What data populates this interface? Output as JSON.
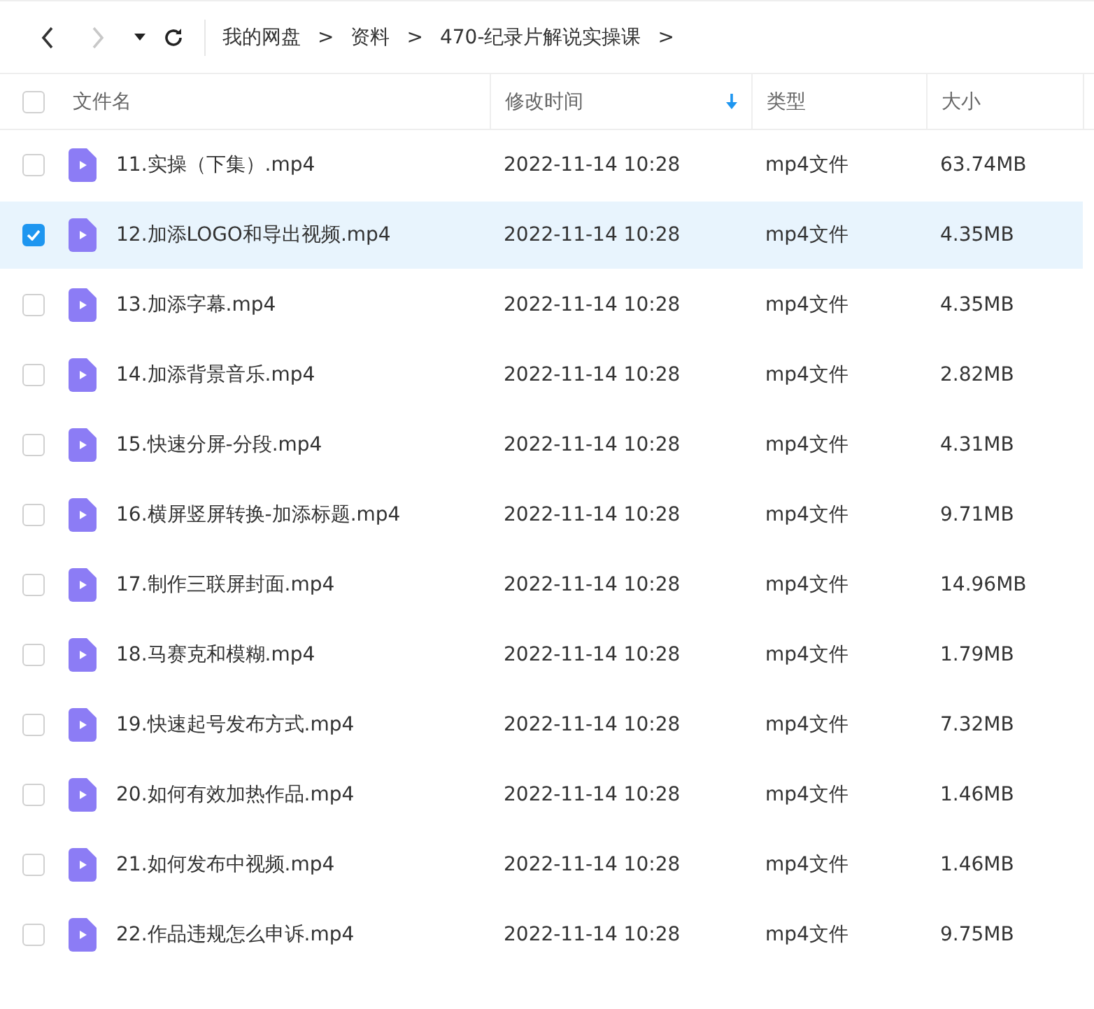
{
  "toolbar": {
    "back": {
      "disabled": false
    },
    "forward": {
      "disabled": true
    }
  },
  "breadcrumb": {
    "separator": ">",
    "items": [
      "我的网盘",
      "资料",
      "470-纪录片解说实操课"
    ]
  },
  "table": {
    "all_checked": false,
    "columns": [
      {
        "label": "文件名",
        "sorted": false
      },
      {
        "label": "修改时间",
        "sorted": true
      },
      {
        "label": "类型",
        "sorted": false
      },
      {
        "label": "大小",
        "sorted": false
      }
    ],
    "rows": [
      {
        "name": "11.实操（下集）.mp4",
        "modified": "2022-11-14 10:28",
        "type": "mp4文件",
        "size": "63.74MB",
        "selected": false
      },
      {
        "name": "12.加添LOGO和导出视频.mp4",
        "modified": "2022-11-14 10:28",
        "type": "mp4文件",
        "size": "4.35MB",
        "selected": true
      },
      {
        "name": "13.加添字幕.mp4",
        "modified": "2022-11-14 10:28",
        "type": "mp4文件",
        "size": "4.35MB",
        "selected": false
      },
      {
        "name": "14.加添背景音乐.mp4",
        "modified": "2022-11-14 10:28",
        "type": "mp4文件",
        "size": "2.82MB",
        "selected": false
      },
      {
        "name": "15.快速分屏-分段.mp4",
        "modified": "2022-11-14 10:28",
        "type": "mp4文件",
        "size": "4.31MB",
        "selected": false
      },
      {
        "name": "16.横屏竖屏转换-加添标题.mp4",
        "modified": "2022-11-14 10:28",
        "type": "mp4文件",
        "size": "9.71MB",
        "selected": false
      },
      {
        "name": "17.制作三联屏封面.mp4",
        "modified": "2022-11-14 10:28",
        "type": "mp4文件",
        "size": "14.96MB",
        "selected": false
      },
      {
        "name": "18.马赛克和模糊.mp4",
        "modified": "2022-11-14 10:28",
        "type": "mp4文件",
        "size": "1.79MB",
        "selected": false
      },
      {
        "name": "19.快速起号发布方式.mp4",
        "modified": "2022-11-14 10:28",
        "type": "mp4文件",
        "size": "7.32MB",
        "selected": false
      },
      {
        "name": "20.如何有效加热作品.mp4",
        "modified": "2022-11-14 10:28",
        "type": "mp4文件",
        "size": "1.46MB",
        "selected": false
      },
      {
        "name": "21.如何发布中视频.mp4",
        "modified": "2022-11-14 10:28",
        "type": "mp4文件",
        "size": "1.46MB",
        "selected": false
      },
      {
        "name": "22.作品违规怎么申诉.mp4",
        "modified": "2022-11-14 10:28",
        "type": "mp4文件",
        "size": "9.75MB",
        "selected": false
      }
    ]
  }
}
